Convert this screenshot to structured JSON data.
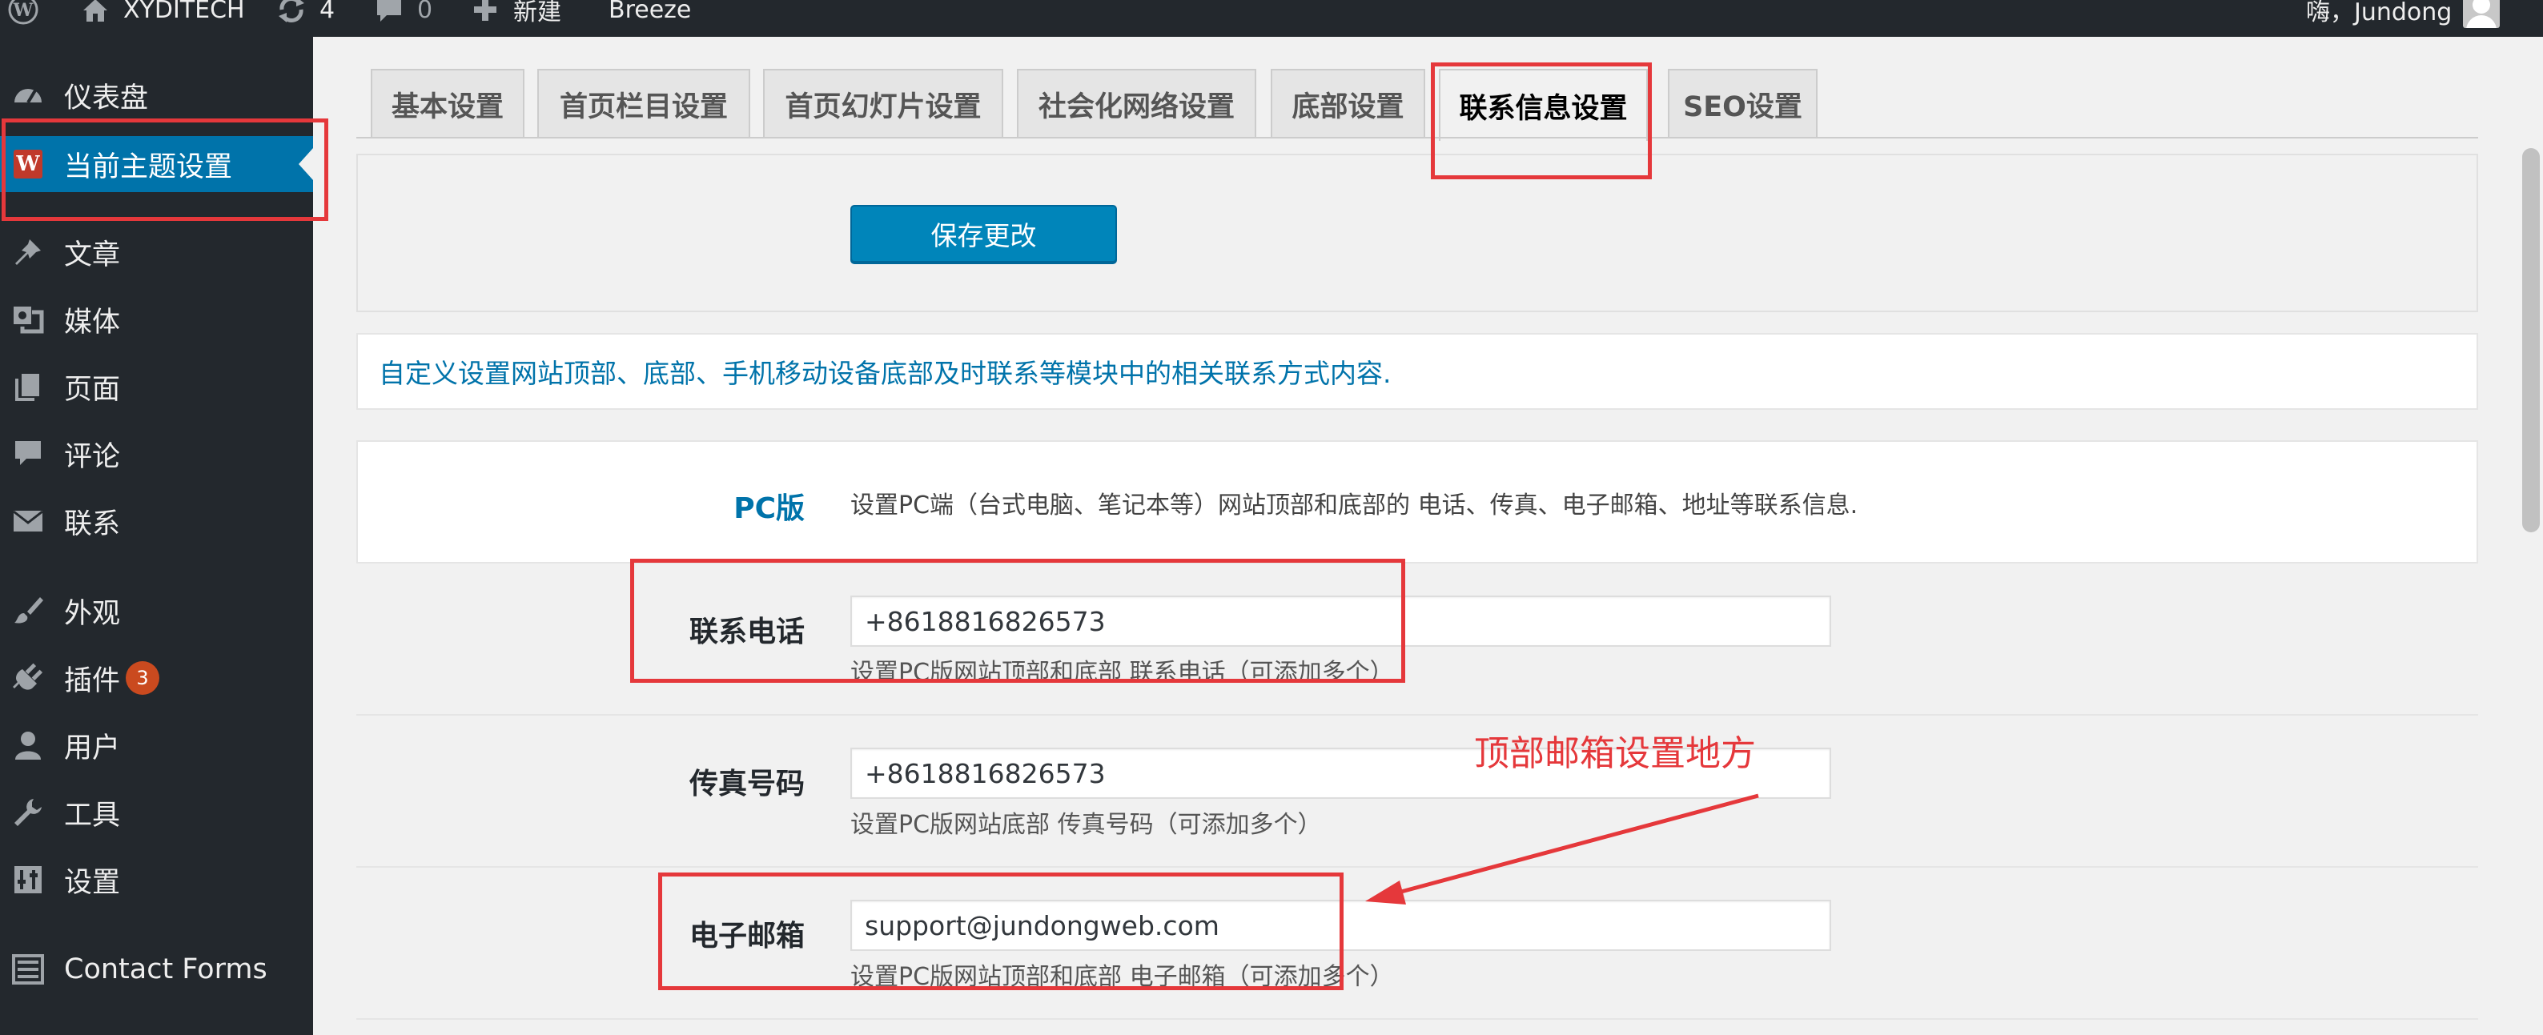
{
  "adminbar": {
    "site_name": "XYDITECH",
    "updates_count": "4",
    "comments_count": "0",
    "new_label": "新建",
    "breeze_label": "Breeze",
    "greeting": "嗨，Jundong"
  },
  "sidebar": {
    "items": [
      {
        "label": "仪表盘",
        "icon": "dashboard-icon"
      },
      {
        "label": "当前主题设置",
        "icon": "theme-w-icon"
      },
      {
        "label": "文章",
        "icon": "pin-icon"
      },
      {
        "label": "媒体",
        "icon": "media-icon"
      },
      {
        "label": "页面",
        "icon": "pages-icon"
      },
      {
        "label": "评论",
        "icon": "comment-icon"
      },
      {
        "label": "联系",
        "icon": "mail-icon"
      },
      {
        "label": "外观",
        "icon": "brush-icon"
      },
      {
        "label": "插件",
        "icon": "plugin-icon",
        "badge": "3"
      },
      {
        "label": "用户",
        "icon": "user-icon"
      },
      {
        "label": "工具",
        "icon": "wrench-icon"
      },
      {
        "label": "设置",
        "icon": "settings-icon"
      },
      {
        "label": "Contact Forms",
        "icon": "list-icon"
      }
    ],
    "theme_logo_letter": "W"
  },
  "tabs": [
    {
      "label": "基本设置"
    },
    {
      "label": "首页栏目设置"
    },
    {
      "label": "首页幻灯片设置"
    },
    {
      "label": "社会化网络设置"
    },
    {
      "label": "底部设置"
    },
    {
      "label": "联系信息设置",
      "active": true
    },
    {
      "label": "SEO设置"
    }
  ],
  "save_button_label": "保存更改",
  "description": "自定义设置网站顶部、底部、手机移动设备底部及时联系等模块中的相关联系方式内容.",
  "form": {
    "pc_label": "PC版",
    "pc_desc": "设置PC端（台式电脑、笔记本等）网站顶部和底部的 电话、传真、电子邮箱、地址等联系信息.",
    "phone": {
      "label": "联系电话",
      "value": "+8618816826573",
      "desc": "设置PC版网站顶部和底部 联系电话（可添加多个）"
    },
    "fax": {
      "label": "传真号码",
      "value": "+8618816826573",
      "desc": "设置PC版网站底部 传真号码（可添加多个）"
    },
    "email": {
      "label": "电子邮箱",
      "value": "support@jundongweb.com",
      "desc": "设置PC版网站顶部和底部 电子邮箱（可添加多个）"
    }
  },
  "annotation": {
    "text": "顶部邮箱设置地方",
    "color": "#e5383b"
  },
  "colors": {
    "adminbar_bg": "#23282d",
    "accent": "#0073aa",
    "button": "#0085ba",
    "badge": "#ca4a1f"
  }
}
